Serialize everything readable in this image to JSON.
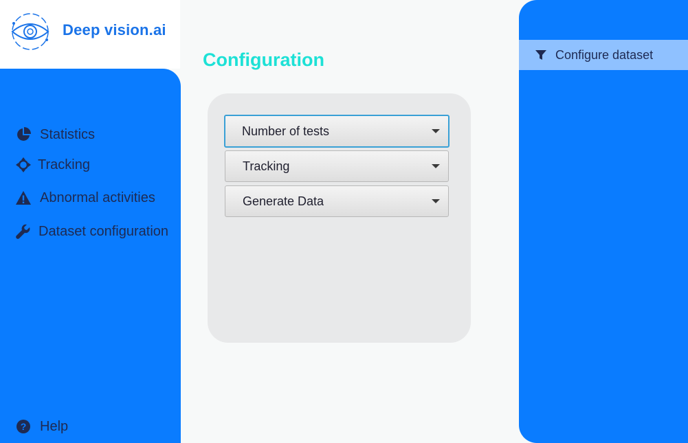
{
  "brand": {
    "name": "Deep vision.ai",
    "logo_icon": "eye-logo-icon",
    "color": "#1a73e8"
  },
  "sidebar": {
    "background": "#0a7cff",
    "items": [
      {
        "label": "Statistics",
        "icon": "pie-chart-icon"
      },
      {
        "label": "Tracking",
        "icon": "crosshair-icon"
      },
      {
        "label": "Abnormal activities",
        "icon": "warning-icon"
      },
      {
        "label": "Dataset configuration",
        "icon": "wrench-icon"
      }
    ],
    "help": {
      "label": "Help",
      "icon": "question-circle-icon"
    }
  },
  "main": {
    "title": "Configuration",
    "title_color": "#1de1d6",
    "selects": [
      {
        "value": "Number of tests",
        "focused": true
      },
      {
        "value": "Tracking",
        "focused": false
      },
      {
        "value": "Generate Data",
        "focused": false
      }
    ]
  },
  "right_panel": {
    "items": [
      {
        "label": "Configure dataset",
        "icon": "filter-icon",
        "active": true
      }
    ]
  }
}
